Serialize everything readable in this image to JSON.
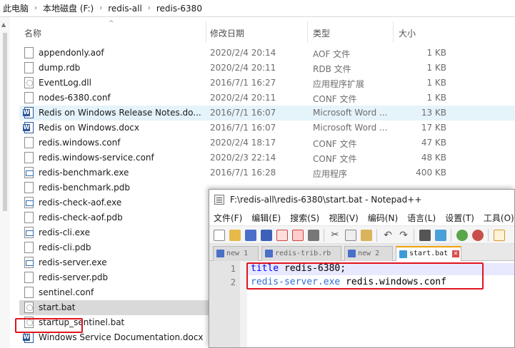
{
  "breadcrumb": [
    "此电脑",
    "本地磁盘 (F:)",
    "redis-all",
    "redis-6380"
  ],
  "columns": {
    "name": "名称",
    "date": "修改日期",
    "type": "类型",
    "size": "大小"
  },
  "files": [
    {
      "name": "appendonly.aof",
      "date": "2020/2/4 20:14",
      "type": "AOF 文件",
      "size": "1 KB",
      "icon": "file-icon"
    },
    {
      "name": "dump.rdb",
      "date": "2020/2/4 20:11",
      "type": "RDB 文件",
      "size": "1 KB",
      "icon": "file-icon"
    },
    {
      "name": "EventLog.dll",
      "date": "2016/7/1 16:27",
      "type": "应用程序扩展",
      "size": "1 KB",
      "icon": "dll-icon"
    },
    {
      "name": "nodes-6380.conf",
      "date": "2020/2/4 20:11",
      "type": "CONF 文件",
      "size": "1 KB",
      "icon": "file-icon"
    },
    {
      "name": "Redis on Windows Release Notes.do...",
      "date": "2016/7/1 16:07",
      "type": "Microsoft Word ...",
      "size": "13 KB",
      "icon": "word-icon"
    },
    {
      "name": "Redis on Windows.docx",
      "date": "2016/7/1 16:07",
      "type": "Microsoft Word ...",
      "size": "17 KB",
      "icon": "word-icon"
    },
    {
      "name": "redis.windows.conf",
      "date": "2020/2/4 18:17",
      "type": "CONF 文件",
      "size": "47 KB",
      "icon": "file-icon"
    },
    {
      "name": "redis.windows-service.conf",
      "date": "2020/2/3 22:14",
      "type": "CONF 文件",
      "size": "48 KB",
      "icon": "file-icon"
    },
    {
      "name": "redis-benchmark.exe",
      "date": "2016/7/1 16:28",
      "type": "应用程序",
      "size": "400 KB",
      "icon": "exe-icon"
    },
    {
      "name": "redis-benchmark.pdb",
      "date": "",
      "type": "",
      "size": "",
      "icon": "file-icon"
    },
    {
      "name": "redis-check-aof.exe",
      "date": "",
      "type": "",
      "size": "",
      "icon": "exe-icon"
    },
    {
      "name": "redis-check-aof.pdb",
      "date": "",
      "type": "",
      "size": "",
      "icon": "file-icon"
    },
    {
      "name": "redis-cli.exe",
      "date": "",
      "type": "",
      "size": "",
      "icon": "exe-icon"
    },
    {
      "name": "redis-cli.pdb",
      "date": "",
      "type": "",
      "size": "",
      "icon": "file-icon"
    },
    {
      "name": "redis-server.exe",
      "date": "",
      "type": "",
      "size": "",
      "icon": "exe-icon"
    },
    {
      "name": "redis-server.pdb",
      "date": "",
      "type": "",
      "size": "",
      "icon": "file-icon"
    },
    {
      "name": "sentinel.conf",
      "date": "",
      "type": "",
      "size": "",
      "icon": "file-icon"
    },
    {
      "name": "start.bat",
      "date": "",
      "type": "",
      "size": "",
      "icon": "bat-icon"
    },
    {
      "name": "startup_sentinel.bat",
      "date": "",
      "type": "",
      "size": "",
      "icon": "bat-icon"
    },
    {
      "name": "Windows Service Documentation.docx",
      "date": "",
      "type": "",
      "size": "",
      "icon": "word-icon"
    }
  ],
  "hovered_file": "Redis on Windows Release Notes.do...",
  "selected_file": "start.bat",
  "notepad": {
    "title": "F:\\redis-all\\redis-6380\\start.bat - Notepad++",
    "menu": [
      "文件(F)",
      "编辑(E)",
      "搜索(S)",
      "视图(V)",
      "编码(N)",
      "语言(L)",
      "设置(T)",
      "工具(O)"
    ],
    "tabs": [
      {
        "label": "new 1"
      },
      {
        "label": "redis-trib.rb"
      },
      {
        "label": "new 2"
      },
      {
        "label": "start.bat",
        "active": true
      }
    ],
    "lines": [
      {
        "num": "1",
        "keyword": "title",
        "rest": " redis-6380;"
      },
      {
        "num": "2",
        "keyword": "redis-server.exe",
        "rest": " redis.windows.conf"
      }
    ]
  },
  "colors": {
    "highlight_box": "#e0141e",
    "active_tab_accent": "#f0a30a",
    "keyword": "#0000ff",
    "current_line": "#e8e8ff"
  }
}
